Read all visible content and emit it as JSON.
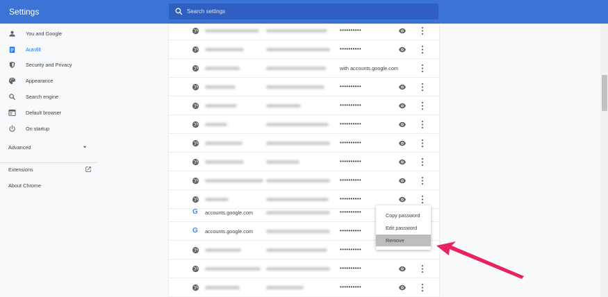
{
  "header": {
    "title": "Settings",
    "search_placeholder": "Search settings"
  },
  "sidebar": {
    "items": [
      {
        "label": "You and Google",
        "icon": "person-icon"
      },
      {
        "label": "Autofill",
        "icon": "clipboard-icon",
        "active": true
      },
      {
        "label": "Security and Privacy",
        "icon": "shield-icon"
      },
      {
        "label": "Appearance",
        "icon": "palette-icon"
      },
      {
        "label": "Search engine",
        "icon": "search-icon"
      },
      {
        "label": "Default browser",
        "icon": "browser-icon"
      },
      {
        "label": "On startup",
        "icon": "power-icon"
      }
    ],
    "advanced": "Advanced",
    "extensions": "Extensions",
    "about": "About Chrome"
  },
  "passwords": {
    "rows": [
      {
        "site": "",
        "username": "",
        "password": "••••••••••",
        "action": "eye"
      },
      {
        "site": "",
        "username": "",
        "password": "••••••••••",
        "action": "eye"
      },
      {
        "site": "",
        "username": "",
        "password": "with accounts.google.com",
        "action": "none"
      },
      {
        "site": "",
        "username": "",
        "password": "••••••••••",
        "action": "eye"
      },
      {
        "site": "",
        "username": "",
        "password": "••••••••••",
        "action": "eye"
      },
      {
        "site": "",
        "username": "",
        "password": "••••••••••",
        "action": "eye"
      },
      {
        "site": "",
        "username": "",
        "password": "••••••••••",
        "action": "eye"
      },
      {
        "site": "",
        "username": "",
        "password": "••••••••••",
        "action": "eye"
      },
      {
        "site": "",
        "username": "",
        "password": "••••••••••",
        "action": "eye"
      },
      {
        "site": "",
        "username": "",
        "password": "••••••••••",
        "action": "eye"
      },
      {
        "site": "accounts.google.com",
        "username": "",
        "password": "••••••••••",
        "action": "eye",
        "google": true
      },
      {
        "site": "accounts.google.com",
        "username": "",
        "password": "••••••••••",
        "action": "eye",
        "google": true
      },
      {
        "site": "",
        "username": "",
        "password": "••••••••••",
        "action": "eye"
      },
      {
        "site": "",
        "username": "",
        "password": "••••••••••",
        "action": "eye"
      },
      {
        "site": "",
        "username": "",
        "password": "••••••••••",
        "action": "eye"
      }
    ]
  },
  "context_menu": {
    "items": [
      "Copy password",
      "Edit password",
      "Remove"
    ],
    "highlighted": "Remove"
  },
  "colors": {
    "header": "#3c73d6",
    "accent": "#1a73e8",
    "annotation_arrow": "#e8245f"
  }
}
